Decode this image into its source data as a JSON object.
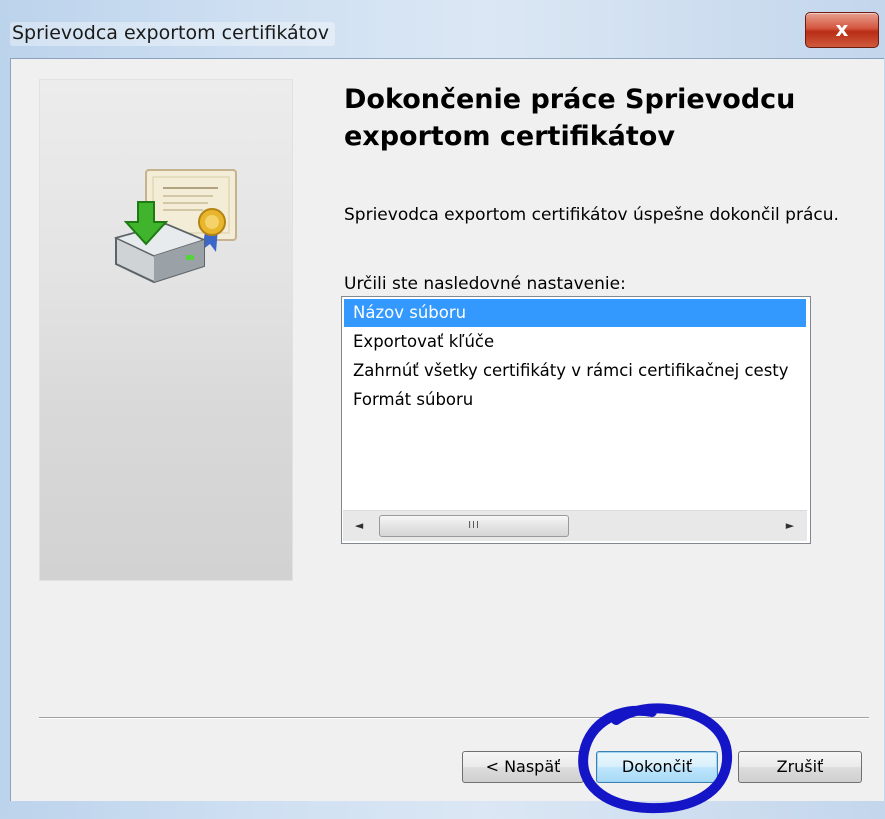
{
  "window": {
    "title": "Sprievodca exportom certifikátov",
    "close_label": "x"
  },
  "main": {
    "heading": "Dokončenie práce Sprievodcu exportom certifikátov",
    "success_text": "Sprievodca exportom certifikátov úspešne dokončil prácu.",
    "settings_label": "Určili ste nasledovné nastavenie:",
    "settings_items": [
      {
        "label": "Názov súboru",
        "selected": true
      },
      {
        "label": "Exportovať kľúče",
        "selected": false
      },
      {
        "label": "Zahrnúť všetky certifikáty v rámci certifikačnej cesty",
        "selected": false
      },
      {
        "label": "Formát súboru",
        "selected": false
      }
    ],
    "scroll_left_glyph": "◄",
    "scroll_right_glyph": "►",
    "scroll_grip_glyph": "III"
  },
  "footer": {
    "back_label": "< Naspäť",
    "finish_label": "Dokončiť",
    "cancel_label": "Zrušiť"
  },
  "icons": {
    "wizard_icon": "certificate-export-icon",
    "close": "close-icon"
  },
  "colors": {
    "selection": "#3399ff",
    "annotation_circle": "#1515c8",
    "close_button": "#c84027"
  }
}
